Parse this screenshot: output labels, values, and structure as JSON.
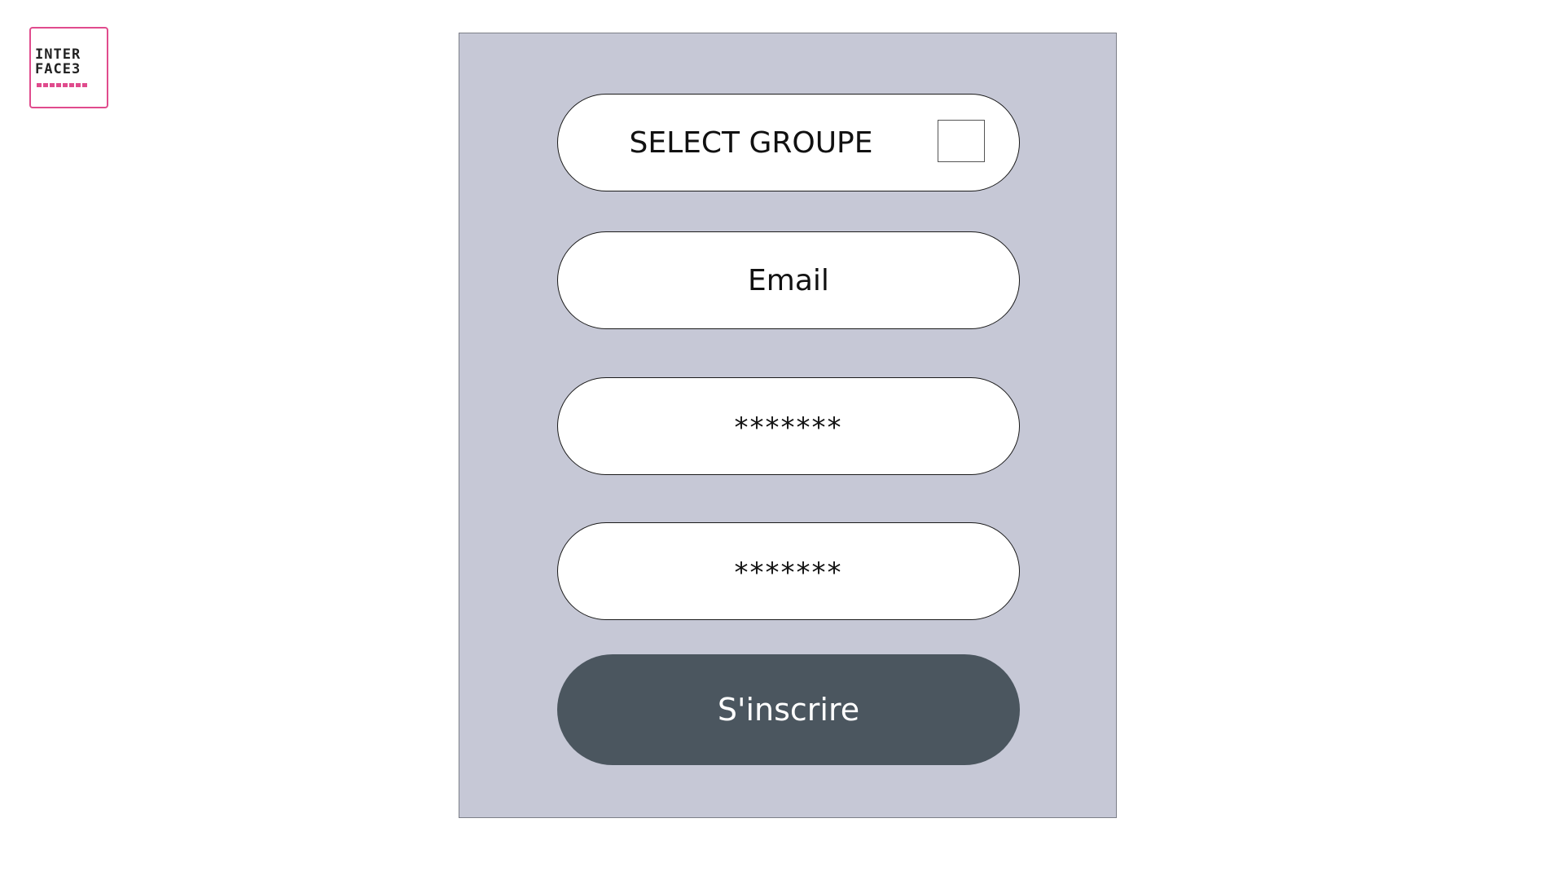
{
  "logo": {
    "line1": "INTER",
    "line2": "FACE3",
    "brand_color": "#e04b8d"
  },
  "form": {
    "background_color": "#c6c8d6",
    "group_select": {
      "label": "SELECT GROUPE",
      "checked": false
    },
    "email": {
      "text": "Email"
    },
    "password": {
      "text": "*******"
    },
    "password_confirm": {
      "text": "*******"
    },
    "submit": {
      "label": "S'inscrire",
      "color": "#4b565f"
    }
  }
}
